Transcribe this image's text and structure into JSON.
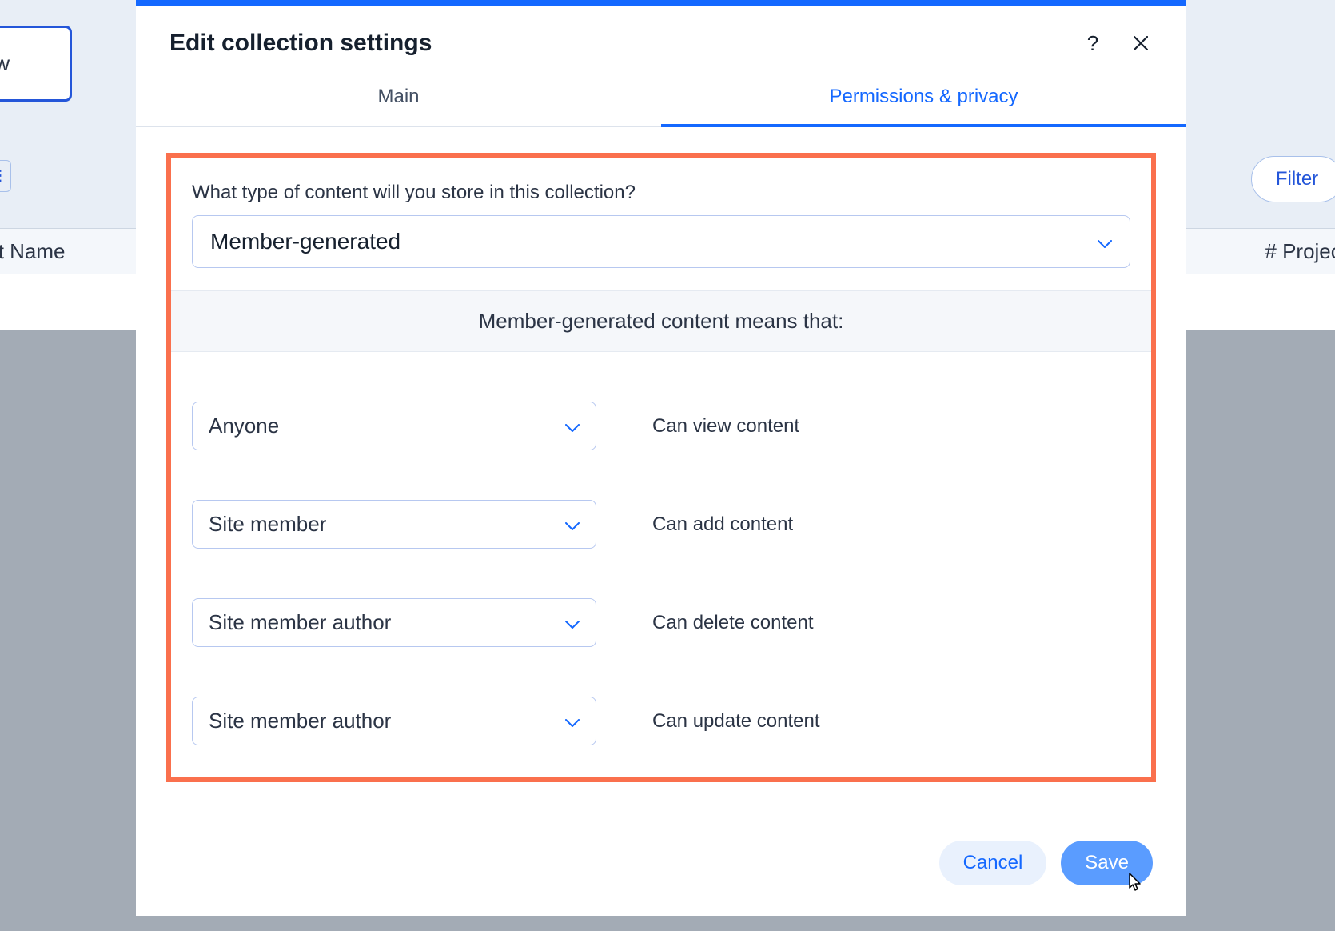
{
  "background": {
    "pill_label": "iew",
    "view_label": "view",
    "filter_label": "Filter",
    "col1": "oject Name",
    "col2": "# Project"
  },
  "modal": {
    "title": "Edit collection settings",
    "tabs": {
      "main": "Main",
      "permissions": "Permissions & privacy"
    },
    "question": "What type of content will you store in this collection?",
    "content_type_value": "Member-generated",
    "info_text": "Member-generated content means that:",
    "permissions": [
      {
        "role": "Anyone",
        "action": "Can view content"
      },
      {
        "role": "Site member",
        "action": "Can add content"
      },
      {
        "role": "Site member author",
        "action": "Can delete content"
      },
      {
        "role": "Site member author",
        "action": "Can update content"
      }
    ],
    "buttons": {
      "cancel": "Cancel",
      "save": "Save"
    }
  }
}
